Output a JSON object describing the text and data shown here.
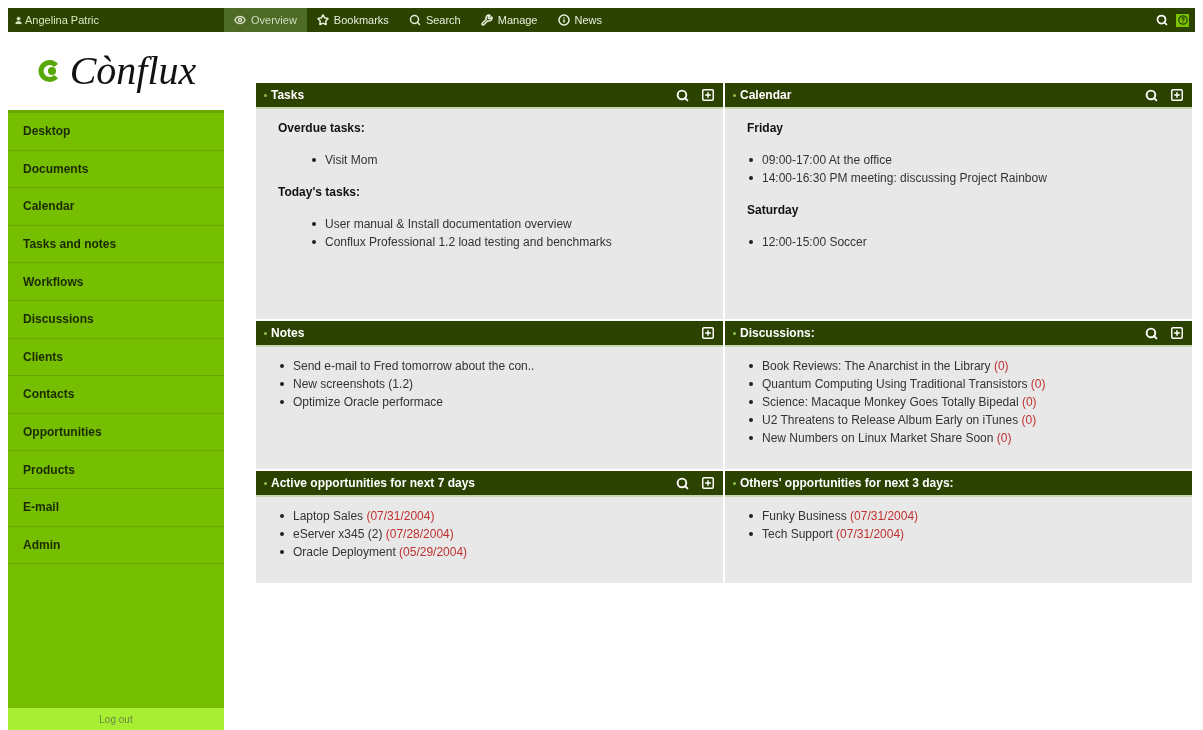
{
  "top_bar": {
    "user": "Angelina Patric",
    "nav": [
      {
        "label": "Overview",
        "kind": "eye",
        "selected": true
      },
      {
        "label": "Bookmarks",
        "kind": "star",
        "selected": false
      },
      {
        "label": "Search",
        "kind": "search",
        "selected": false
      },
      {
        "label": "Manage",
        "kind": "wrench",
        "selected": false
      },
      {
        "label": "News",
        "kind": "info",
        "selected": false
      }
    ]
  },
  "logo": {
    "text": "Cònflux"
  },
  "sidebar": {
    "items": [
      {
        "label": "Desktop"
      },
      {
        "label": "Documents"
      },
      {
        "label": "Calendar"
      },
      {
        "label": "Tasks and notes"
      },
      {
        "label": "Workflows"
      },
      {
        "label": "Discussions"
      },
      {
        "label": "Clients"
      },
      {
        "label": "Contacts"
      },
      {
        "label": "Opportunities"
      },
      {
        "label": "Products"
      },
      {
        "label": "E-mail"
      },
      {
        "label": "Admin"
      }
    ],
    "logout": "Log out"
  },
  "panels": [
    {
      "title": "Tasks",
      "search": true,
      "add": true,
      "sections": [
        {
          "heading": "Overdue tasks:",
          "items": [
            {
              "text": "Visit Mom"
            }
          ]
        },
        {
          "heading": "Today's tasks:",
          "items": [
            {
              "text": "User manual & Install documentation overview"
            },
            {
              "text": "Conflux Professional 1.2 load testing and benchmarks"
            }
          ]
        }
      ]
    },
    {
      "title": "Calendar",
      "search": true,
      "add": true,
      "sections": [
        {
          "heading": "Friday",
          "items": [
            {
              "text": "09:00-17:00 At the office"
            },
            {
              "text": "14:00-16:30 PM meeting: discussing Project Rainbow"
            }
          ]
        },
        {
          "heading": "Saturday",
          "items": [
            {
              "text": "12:00-15:00 Soccer"
            }
          ]
        }
      ]
    },
    {
      "title": "Notes",
      "search": false,
      "add": true,
      "sections": [
        {
          "items": [
            {
              "text": "Send e-mail to Fred tomorrow about the con.."
            },
            {
              "text": "New screenshots (1.2)"
            },
            {
              "text": "Optimize Oracle performace"
            }
          ]
        }
      ]
    },
    {
      "title": "Discussions:",
      "search": true,
      "add": true,
      "sections": [
        {
          "items": [
            {
              "text": "Book Reviews: The Anarchist in the Library",
              "extra": "(0)"
            },
            {
              "text": "Quantum Computing Using Traditional Transistors",
              "extra": "(0)"
            },
            {
              "text": "Science: Macaque Monkey Goes Totally Bipedal",
              "extra": "(0)"
            },
            {
              "text": "U2 Threatens to Release Album Early on iTunes",
              "extra": "(0)"
            },
            {
              "text": "New Numbers on Linux Market Share Soon",
              "extra": "(0)"
            }
          ]
        }
      ]
    },
    {
      "title": "Active opportunities for next 7 days",
      "search": true,
      "add": true,
      "sections": [
        {
          "items": [
            {
              "text": "Laptop Sales",
              "extra": "(07/31/2004)"
            },
            {
              "text": "eServer x345 (2)",
              "extra": "(07/28/2004)"
            },
            {
              "text": "Oracle Deployment",
              "extra": "(05/29/2004)"
            }
          ]
        }
      ]
    },
    {
      "title": "Others' opportunities for next 3 days:",
      "search": false,
      "add": false,
      "sections": [
        {
          "items": [
            {
              "text": "Funky Business",
              "extra": "(07/31/2004)"
            },
            {
              "text": "Tech Support",
              "extra": "(07/31/2004)"
            }
          ]
        }
      ]
    }
  ]
}
